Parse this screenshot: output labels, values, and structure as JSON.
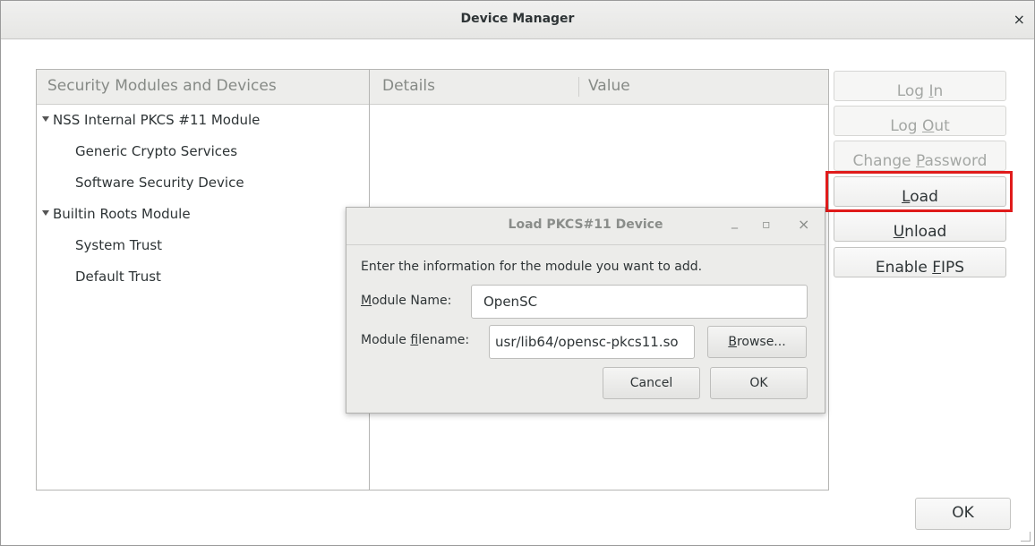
{
  "window": {
    "title": "Device Manager",
    "close_glyph": "×"
  },
  "modules_pane": {
    "header": "Security Modules and Devices",
    "items": [
      {
        "label": "NSS Internal PKCS #11 Module"
      },
      {
        "label": "Generic Crypto Services"
      },
      {
        "label": "Software Security Device"
      },
      {
        "label": "Builtin Roots Module"
      },
      {
        "label": "System Trust"
      },
      {
        "label": "Default Trust"
      }
    ]
  },
  "details_pane": {
    "col_details": "Details",
    "col_value": "Value"
  },
  "side_buttons": {
    "login": {
      "pre": "Log ",
      "key": "I",
      "post": "n"
    },
    "logout": {
      "pre": "Log ",
      "key": "O",
      "post": "ut"
    },
    "change_password": {
      "pre": "Change ",
      "key": "P",
      "post": "assword"
    },
    "load": {
      "pre": "",
      "key": "L",
      "post": "oad"
    },
    "unload": {
      "pre": "",
      "key": "U",
      "post": "nload"
    },
    "enable_fips": {
      "pre": "Enable ",
      "key": "F",
      "post": "IPS"
    }
  },
  "ok_button": "OK",
  "dialog": {
    "title": "Load PKCS#11 Device",
    "minimize_glyph": "_",
    "maximize_glyph": "▫",
    "close_glyph": "×",
    "instruction": "Enter the information for the module you want to add.",
    "module_name_label": {
      "key": "M",
      "rest": "odule Name:"
    },
    "module_name_value": "OpenSC",
    "module_filename_label": {
      "pre": "Module ",
      "key": "f",
      "rest": "ilename:"
    },
    "module_filename_value": "usr/lib64/opensc-pkcs11.so",
    "browse_button": {
      "key": "B",
      "rest": "rowse..."
    },
    "cancel_button": "Cancel",
    "ok_button": "OK"
  },
  "colors": {
    "highlight": "#e01b1b",
    "disabled_text": "#a4a7a4"
  }
}
